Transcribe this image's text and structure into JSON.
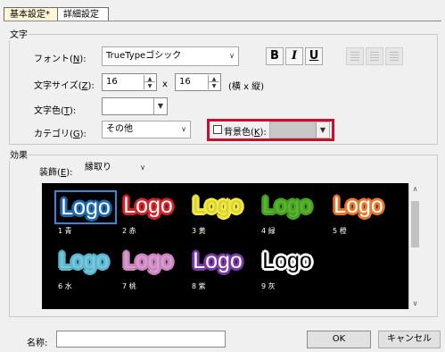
{
  "tabs": [
    {
      "label": "基本設定",
      "dirty_mark": "*"
    },
    {
      "label": "詳細設定"
    }
  ],
  "text_group": {
    "title": "文字",
    "font": {
      "label": "フォント(",
      "key": "N",
      "suffix": "):",
      "value": "TrueTypeゴシック"
    },
    "format_buttons": {
      "bold": "B",
      "italic": "I",
      "underline": "U"
    },
    "size": {
      "label": "文字サイズ(",
      "key": "Z",
      "suffix": "):",
      "width": "16",
      "x_sep": "x",
      "height": "16",
      "hint": "(横 x 縦)"
    },
    "text_color": {
      "label": "文字色(",
      "key": "T",
      "suffix": "):"
    },
    "bg_color": {
      "label": "背景色(",
      "key": "K",
      "suffix": "):",
      "checked": false
    },
    "category": {
      "label": "カテゴリ(",
      "key": "G",
      "suffix": "):",
      "value": "その他"
    }
  },
  "effect_group": {
    "title": "効果",
    "decoration": {
      "label": "装飾(",
      "key": "E",
      "suffix": "):",
      "value": "縁取り"
    },
    "styles": [
      {
        "text": "Logo",
        "caption": "1 青",
        "fill": "#ffffff",
        "outline": "#1e6ab0",
        "selected": true
      },
      {
        "text": "Logo",
        "caption": "2 赤",
        "fill": "#ffffff",
        "outline": "#d8232a"
      },
      {
        "text": "Logo",
        "caption": "3 黄",
        "fill": "#d9cf3a",
        "outline": "#f1e840"
      },
      {
        "text": "Logo",
        "caption": "4 緑",
        "fill": "#5cb833",
        "outline": "#47a124"
      },
      {
        "text": "Logo",
        "caption": "5 橙",
        "fill": "#ffffff",
        "outline": "#e9782a"
      },
      {
        "text": "Logo",
        "caption": "6 水",
        "fill": "#7cc9dc",
        "outline": "#5bb8d0"
      },
      {
        "text": "Logo",
        "caption": "7 桃",
        "fill": "#d9a0cf",
        "outline": "#cc85c0"
      },
      {
        "text": "Logo",
        "caption": "8 紫",
        "fill": "#ffffff",
        "outline": "#7b3aa8"
      },
      {
        "text": "Logo",
        "caption": "9 灰",
        "fill": "#000000",
        "outline": "#ffffff"
      }
    ]
  },
  "footer": {
    "name_label": "名称:",
    "name_value": "",
    "ok_label": "OK",
    "cancel_label": "キャンセル"
  },
  "colors": {
    "accent_red": "#c8102e",
    "selection_blue": "#2e8bd8"
  }
}
